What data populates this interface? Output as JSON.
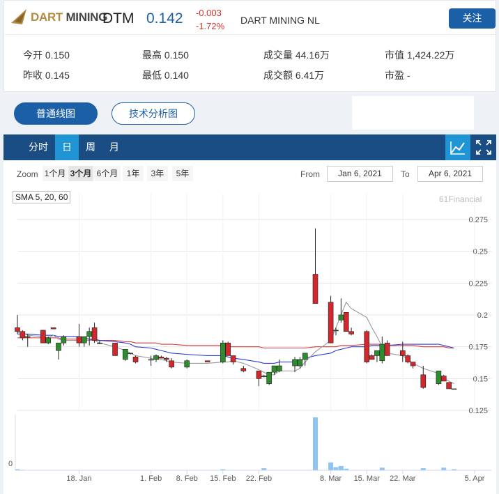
{
  "header": {
    "logo_text_accent": "DART",
    "logo_text_rest": " MINING",
    "symbol": "DTM",
    "price": "0.142",
    "change": "-0.003",
    "change_pct": "-1.72%",
    "company_name": "DART MINING NL",
    "follow_label": "关注"
  },
  "stats": {
    "open": "今开 0.150",
    "high": "最高 0.150",
    "volume": "成交量 44.16万",
    "market_cap": "市值 1,424.22万",
    "prev_close": "昨收 0.145",
    "low": "最低 0.140",
    "turnover": "成交额 6.41万",
    "pe": "市盈 -"
  },
  "chart_type_buttons": {
    "normal": "普通线图",
    "technical": "技术分析图"
  },
  "period_tabs": [
    "分时",
    "日",
    "周",
    "月"
  ],
  "active_period": "日",
  "zoom": {
    "label": "Zoom",
    "options": [
      "1个月",
      "3个月",
      "6个月",
      "1年",
      "3年",
      "5年"
    ],
    "selected": "3个月",
    "from_label": "From",
    "from_value": "Jan 6, 2021",
    "to_label": "To",
    "to_value": "Apr 6, 2021"
  },
  "sma_label": "SMA 5, 20, 60",
  "credit": "61Financial",
  "colors": {
    "up": "#2e8b2e",
    "down": "#d0282c",
    "sma5": "#9a9a9a",
    "sma20": "#2a3fd4",
    "sma60": "#d83a3a",
    "volume": "#8ec4ef",
    "brand": "#1b5fa7",
    "tab_active": "#1f95d6"
  },
  "chart_data": {
    "type": "candlestick",
    "y_ticks": [
      "0.275",
      "0.25",
      "0.225",
      "0.2",
      "0.175",
      "0.15",
      "0.125"
    ],
    "ylim": [
      0.125,
      0.275
    ],
    "x_ticks": [
      "18. Jan",
      "1. Feb",
      "8. Feb",
      "15. Feb",
      "22. Feb",
      "8. Mar",
      "15. Mar",
      "22. Mar",
      "5. Apr"
    ],
    "volume_tick": "0",
    "candles": [
      {
        "date": "2021-01-06",
        "o": 0.19,
        "h": 0.2,
        "l": 0.185,
        "c": 0.187
      },
      {
        "date": "2021-01-07",
        "o": 0.187,
        "h": 0.188,
        "l": 0.18,
        "c": 0.182
      },
      {
        "date": "2021-01-08",
        "o": 0.183,
        "h": 0.185,
        "l": 0.175,
        "c": 0.183
      },
      {
        "date": "2021-01-11",
        "o": 0.188,
        "h": 0.188,
        "l": 0.178,
        "c": 0.178
      },
      {
        "date": "2021-01-12",
        "o": 0.178,
        "h": 0.183,
        "l": 0.177,
        "c": 0.182
      },
      {
        "date": "2021-01-13",
        "o": 0.19,
        "h": 0.19,
        "l": 0.189,
        "c": 0.189
      },
      {
        "date": "2021-01-14",
        "o": 0.172,
        "h": 0.178,
        "l": 0.165,
        "c": 0.178
      },
      {
        "date": "2021-01-15",
        "o": 0.178,
        "h": 0.184,
        "l": 0.176,
        "c": 0.183
      },
      {
        "date": "2021-01-18",
        "o": 0.183,
        "h": 0.193,
        "l": 0.175,
        "c": 0.178
      },
      {
        "date": "2021-01-19",
        "o": 0.178,
        "h": 0.183,
        "l": 0.175,
        "c": 0.183
      },
      {
        "date": "2021-01-20",
        "o": 0.183,
        "h": 0.19,
        "l": 0.176,
        "c": 0.187
      },
      {
        "date": "2021-01-21",
        "o": 0.19,
        "h": 0.194,
        "l": 0.178,
        "c": 0.18
      },
      {
        "date": "2021-01-22",
        "o": 0.178,
        "h": 0.18,
        "l": 0.177,
        "c": 0.178
      },
      {
        "date": "2021-01-25",
        "o": 0.178,
        "h": 0.178,
        "l": 0.168,
        "c": 0.168
      },
      {
        "date": "2021-01-27",
        "o": 0.165,
        "h": 0.173,
        "l": 0.164,
        "c": 0.173
      },
      {
        "date": "2021-01-28",
        "o": 0.17,
        "h": 0.17,
        "l": 0.169,
        "c": 0.17
      },
      {
        "date": "2021-01-29",
        "o": 0.167,
        "h": 0.168,
        "l": 0.162,
        "c": 0.163
      },
      {
        "date": "2021-02-01",
        "o": 0.165,
        "h": 0.168,
        "l": 0.16,
        "c": 0.165
      },
      {
        "date": "2021-02-02",
        "o": 0.165,
        "h": 0.169,
        "l": 0.163,
        "c": 0.168
      },
      {
        "date": "2021-02-03",
        "o": 0.167,
        "h": 0.168,
        "l": 0.166,
        "c": 0.166
      },
      {
        "date": "2021-02-04",
        "o": 0.166,
        "h": 0.167,
        "l": 0.163,
        "c": 0.165
      },
      {
        "date": "2021-02-05",
        "o": 0.164,
        "h": 0.166,
        "l": 0.158,
        "c": 0.159
      },
      {
        "date": "2021-02-08",
        "o": 0.159,
        "h": 0.165,
        "l": 0.158,
        "c": 0.164
      },
      {
        "date": "2021-02-12",
        "o": 0.164,
        "h": 0.164,
        "l": 0.163,
        "c": 0.163
      },
      {
        "date": "2021-02-15",
        "o": 0.163,
        "h": 0.18,
        "l": 0.162,
        "c": 0.178
      },
      {
        "date": "2021-02-16",
        "o": 0.178,
        "h": 0.179,
        "l": 0.168,
        "c": 0.168
      },
      {
        "date": "2021-02-17",
        "o": 0.168,
        "h": 0.168,
        "l": 0.161,
        "c": 0.163
      },
      {
        "date": "2021-02-19",
        "o": 0.158,
        "h": 0.16,
        "l": 0.155,
        "c": 0.156
      },
      {
        "date": "2021-02-22",
        "o": 0.156,
        "h": 0.156,
        "l": 0.144,
        "c": 0.15
      },
      {
        "date": "2021-02-23",
        "o": 0.152,
        "h": 0.153,
        "l": 0.151,
        "c": 0.152
      },
      {
        "date": "2021-02-24",
        "o": 0.146,
        "h": 0.155,
        "l": 0.145,
        "c": 0.155
      },
      {
        "date": "2021-02-25",
        "o": 0.155,
        "h": 0.16,
        "l": 0.153,
        "c": 0.16
      },
      {
        "date": "2021-02-26",
        "o": 0.156,
        "h": 0.165,
        "l": 0.155,
        "c": 0.16
      },
      {
        "date": "2021-03-01",
        "o": 0.16,
        "h": 0.167,
        "l": 0.155,
        "c": 0.165
      },
      {
        "date": "2021-03-02",
        "o": 0.16,
        "h": 0.167,
        "l": 0.158,
        "c": 0.165
      },
      {
        "date": "2021-03-03",
        "o": 0.165,
        "h": 0.17,
        "l": 0.16,
        "c": 0.17
      },
      {
        "date": "2021-03-05",
        "o": 0.232,
        "h": 0.268,
        "l": 0.21,
        "c": 0.209
      },
      {
        "date": "2021-03-08",
        "o": 0.21,
        "h": 0.215,
        "l": 0.178,
        "c": 0.178
      },
      {
        "date": "2021-03-09",
        "o": 0.188,
        "h": 0.19,
        "l": 0.184,
        "c": 0.188
      },
      {
        "date": "2021-03-10",
        "o": 0.196,
        "h": 0.213,
        "l": 0.194,
        "c": 0.2
      },
      {
        "date": "2021-03-11",
        "o": 0.202,
        "h": 0.202,
        "l": 0.187,
        "c": 0.187
      },
      {
        "date": "2021-03-12",
        "o": 0.187,
        "h": 0.19,
        "l": 0.184,
        "c": 0.185
      },
      {
        "date": "2021-03-15",
        "o": 0.187,
        "h": 0.188,
        "l": 0.162,
        "c": 0.163
      },
      {
        "date": "2021-03-16",
        "o": 0.168,
        "h": 0.169,
        "l": 0.165,
        "c": 0.165
      },
      {
        "date": "2021-03-17",
        "o": 0.168,
        "h": 0.172,
        "l": 0.163,
        "c": 0.172
      },
      {
        "date": "2021-03-18",
        "o": 0.164,
        "h": 0.183,
        "l": 0.162,
        "c": 0.177
      },
      {
        "date": "2021-03-19",
        "o": 0.178,
        "h": 0.18,
        "l": 0.168,
        "c": 0.168
      },
      {
        "date": "2021-03-22",
        "o": 0.172,
        "h": 0.179,
        "l": 0.163,
        "c": 0.168
      },
      {
        "date": "2021-03-23",
        "o": 0.168,
        "h": 0.169,
        "l": 0.162,
        "c": 0.163
      },
      {
        "date": "2021-03-24",
        "o": 0.163,
        "h": 0.163,
        "l": 0.158,
        "c": 0.16
      },
      {
        "date": "2021-03-26",
        "o": 0.153,
        "h": 0.16,
        "l": 0.142,
        "c": 0.143
      },
      {
        "date": "2021-03-29",
        "o": 0.146,
        "h": 0.156,
        "l": 0.145,
        "c": 0.156
      },
      {
        "date": "2021-03-30",
        "o": 0.152,
        "h": 0.153,
        "l": 0.148,
        "c": 0.148
      },
      {
        "date": "2021-03-31",
        "o": 0.147,
        "h": 0.147,
        "l": 0.142,
        "c": 0.142
      },
      {
        "date": "2021-04-01",
        "o": 0.142,
        "h": 0.142,
        "l": 0.142,
        "c": 0.142
      }
    ],
    "sma5": [
      0.186,
      0.186,
      0.184,
      0.183,
      0.182,
      0.184,
      0.181,
      0.18,
      0.18,
      0.18,
      0.18,
      0.18,
      0.178,
      0.175,
      0.172,
      0.17,
      0.168,
      0.166,
      0.165,
      0.165,
      0.164,
      0.163,
      0.162,
      0.162,
      0.163,
      0.163,
      0.164,
      0.162,
      0.157,
      0.155,
      0.153,
      0.153,
      0.156,
      0.156,
      0.158,
      0.163,
      0.171,
      0.18,
      0.19,
      0.2,
      0.21,
      0.205,
      0.198,
      0.19,
      0.183,
      0.175,
      0.17,
      0.168,
      0.165,
      0.162,
      0.158,
      0.154,
      0.15,
      0.148,
      0.146
    ],
    "sma20": [
      0.185,
      0.185,
      0.185,
      0.184,
      0.184,
      0.184,
      0.183,
      0.183,
      0.183,
      0.182,
      0.181,
      0.181,
      0.18,
      0.179,
      0.178,
      0.177,
      0.175,
      0.174,
      0.173,
      0.172,
      0.171,
      0.17,
      0.169,
      0.168,
      0.168,
      0.167,
      0.166,
      0.165,
      0.163,
      0.162,
      0.162,
      0.162,
      0.163,
      0.163,
      0.164,
      0.166,
      0.168,
      0.17,
      0.172,
      0.173,
      0.174,
      0.175,
      0.175,
      0.176,
      0.176,
      0.176,
      0.176,
      0.177,
      0.177,
      0.177,
      0.177,
      0.177,
      0.176,
      0.175,
      0.174
    ],
    "sma60": [
      0.182,
      0.182,
      0.182,
      0.182,
      0.182,
      0.182,
      0.182,
      0.181,
      0.181,
      0.181,
      0.181,
      0.18,
      0.18,
      0.18,
      0.179,
      0.179,
      0.178,
      0.178,
      0.178,
      0.177,
      0.177,
      0.177,
      0.176,
      0.176,
      0.176,
      0.175,
      0.175,
      0.175,
      0.175,
      0.174,
      0.174,
      0.174,
      0.174,
      0.174,
      0.174,
      0.174,
      0.175,
      0.175,
      0.175,
      0.176,
      0.176,
      0.176,
      0.177,
      0.177,
      0.177,
      0.177,
      0.176,
      0.176,
      0.176,
      0.176,
      0.175,
      0.175,
      0.175,
      0.174,
      0.174
    ],
    "volume_rel": [
      0.02,
      0.01,
      0,
      0,
      0,
      0,
      0,
      0,
      0,
      0,
      0,
      0,
      0,
      0,
      0,
      0,
      0,
      0,
      0,
      0,
      0,
      0,
      0,
      0,
      0.02,
      0,
      0,
      0,
      0,
      0.04,
      0,
      0,
      0,
      0,
      0,
      0,
      1.0,
      0.15,
      0.06,
      0.08,
      0.03,
      0,
      0,
      0,
      0,
      0.05,
      0,
      0,
      0,
      0,
      0.04,
      0,
      0.05,
      0,
      0.02
    ]
  }
}
